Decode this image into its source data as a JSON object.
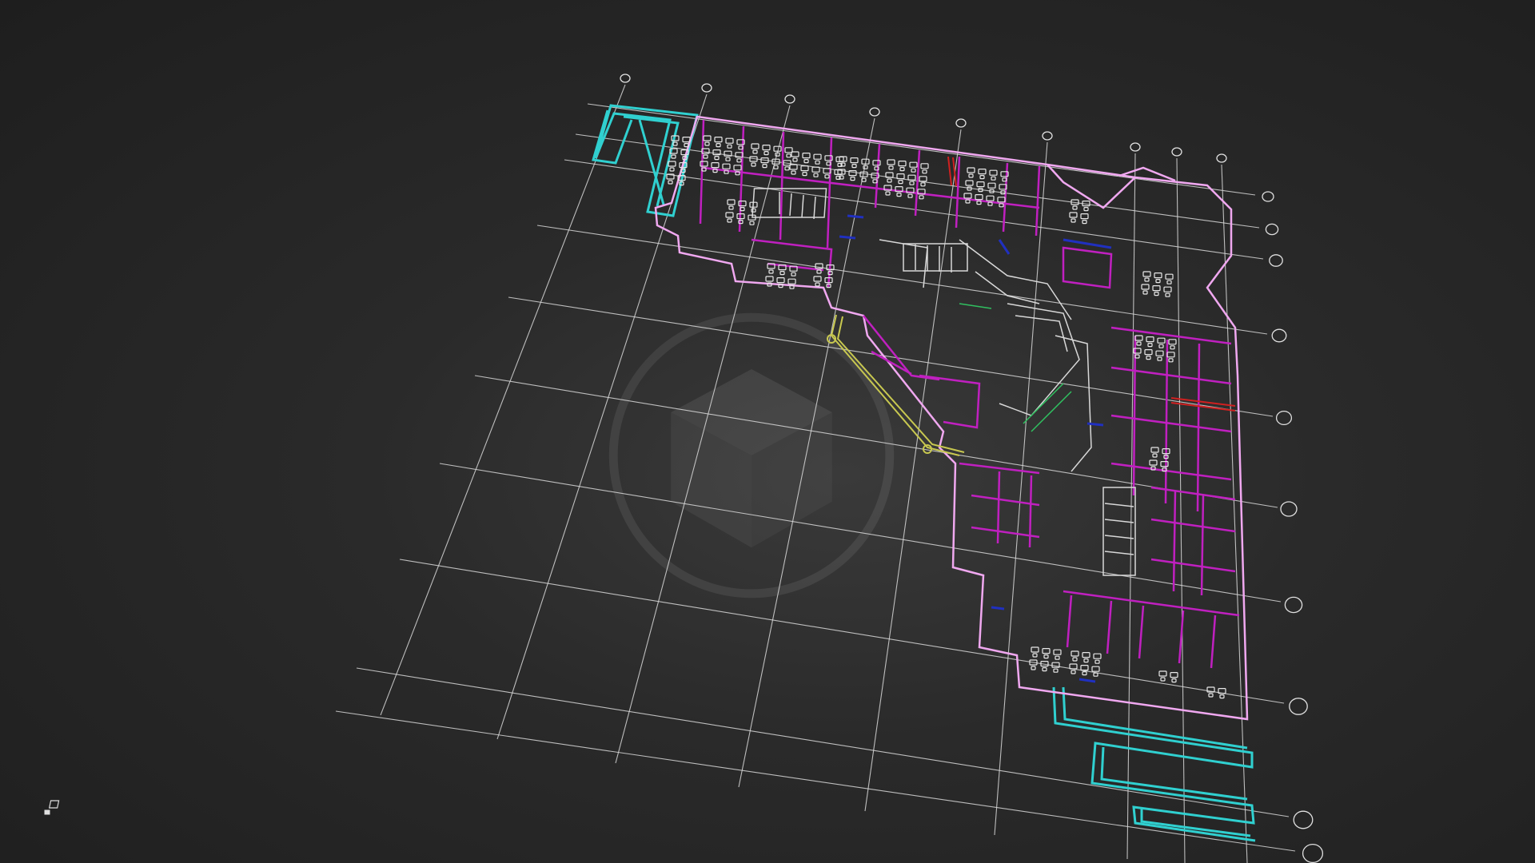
{
  "viewer": {
    "mode": "3D model viewer",
    "background_color": "#1f1f1f"
  },
  "colors": {
    "grid": "#d8d8d8",
    "grid_bubble": "#e0e0e0",
    "exterior_wall": "#f0a8f0",
    "interior_partition": "#c020c0",
    "furniture": "#e8e8e8",
    "curtain_wall": "#30d0d0",
    "circulation": "#c8c850",
    "doors": "#2030c0",
    "highlight": "#d02020"
  },
  "icons": {
    "watermark": "sketchfab-logo-icon",
    "viewcube": "viewcube-icon"
  }
}
